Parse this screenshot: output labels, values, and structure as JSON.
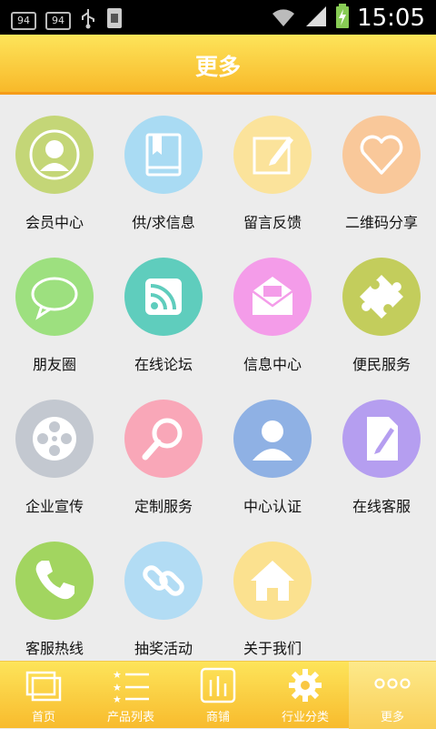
{
  "status_bar": {
    "left_box_1": "94",
    "left_box_2": "94",
    "time": "15:05"
  },
  "header": {
    "title": "更多"
  },
  "grid": {
    "items": [
      {
        "label": "会员中心",
        "icon": "person-icon",
        "color": "#c4d677"
      },
      {
        "label": "供/求信息",
        "icon": "book-icon",
        "color": "#a9dbf3"
      },
      {
        "label": "留言反馈",
        "icon": "edit-note-icon",
        "color": "#fbe39b"
      },
      {
        "label": "二维码分享",
        "icon": "heart-icon",
        "color": "#f9c89a"
      },
      {
        "label": "朋友圈",
        "icon": "chat-bubble-icon",
        "color": "#9de07f"
      },
      {
        "label": "在线论坛",
        "icon": "rss-icon",
        "color": "#5fcdbd"
      },
      {
        "label": "信息中心",
        "icon": "mail-icon",
        "color": "#f49ce9"
      },
      {
        "label": "便民服务",
        "icon": "puzzle-icon",
        "color": "#c3cd5c"
      },
      {
        "label": "企业宣传",
        "icon": "film-reel-icon",
        "color": "#c3c8d0"
      },
      {
        "label": "定制服务",
        "icon": "magnifier-icon",
        "color": "#f9a7b8"
      },
      {
        "label": "中心认证",
        "icon": "user-avatar-icon",
        "color": "#8fb1e4"
      },
      {
        "label": "在线客服",
        "icon": "document-edit-icon",
        "color": "#b59ef0"
      },
      {
        "label": "客服热线",
        "icon": "phone-icon",
        "color": "#a2d560"
      },
      {
        "label": "抽奖活动",
        "icon": "link-icon",
        "color": "#b2dcf4"
      },
      {
        "label": "关于我们",
        "icon": "home-icon",
        "color": "#fbe18f"
      }
    ]
  },
  "tabbar": {
    "tabs": [
      {
        "label": "首页",
        "icon": "windows-icon"
      },
      {
        "label": "产品列表",
        "icon": "star-list-icon"
      },
      {
        "label": "商铺",
        "icon": "shop-icon"
      },
      {
        "label": "行业分类",
        "icon": "gear-icon"
      },
      {
        "label": "更多",
        "icon": "more-dots-icon"
      }
    ],
    "active_index": 4
  }
}
